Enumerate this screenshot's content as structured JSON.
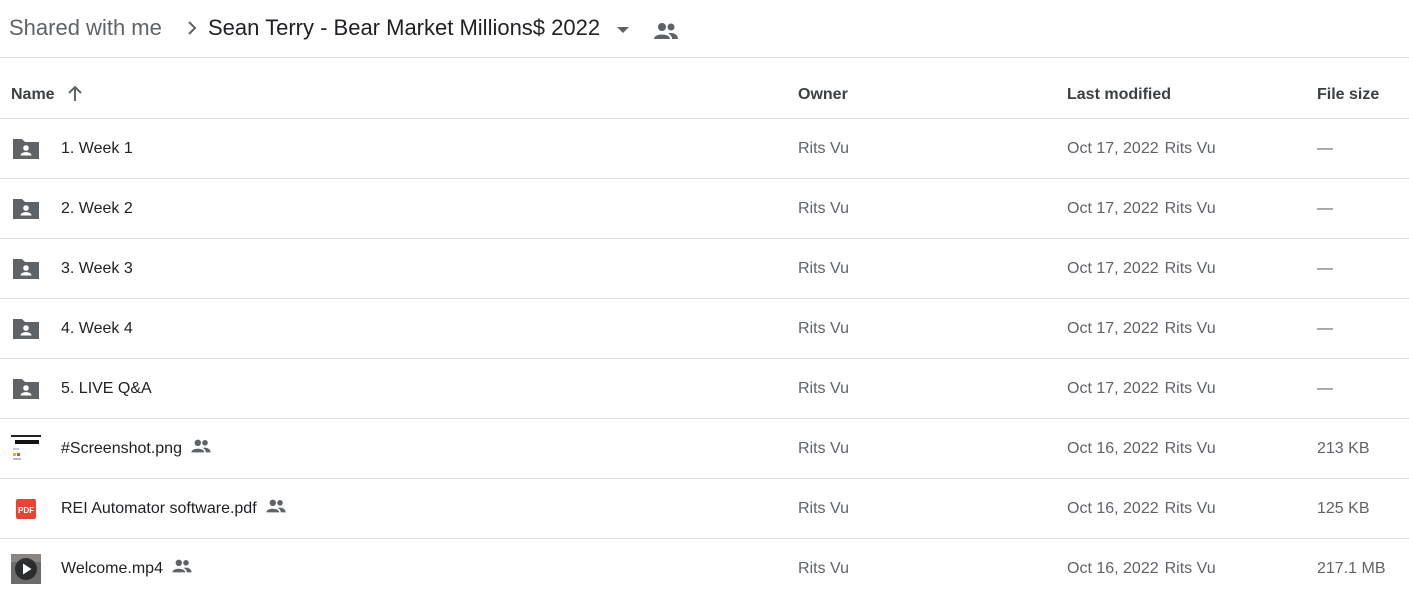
{
  "breadcrumb": {
    "root": "Shared with me",
    "current": "Sean Terry - Bear Market Millions$ 2022",
    "separator_icon": "chevron-right-icon",
    "dropdown_icon": "caret-down-icon",
    "shared_icon": "people-icon"
  },
  "columns": {
    "name": "Name",
    "owner": "Owner",
    "last_modified": "Last modified",
    "file_size": "File size",
    "sort_icon": "arrow-up-icon"
  },
  "colors": {
    "text_primary": "#202124",
    "text_secondary": "#5f6368",
    "divider": "#dadce0",
    "folder_icon": "#5f6368",
    "pdf_red": "#ea4335"
  },
  "files": [
    {
      "name": "1. Week 1",
      "type": "shared-folder",
      "icon": "shared-folder-icon",
      "owner": "Rits Vu",
      "modified_date": "Oct 17, 2022",
      "modified_by": "Rits Vu",
      "size": "—"
    },
    {
      "name": "2. Week 2",
      "type": "shared-folder",
      "icon": "shared-folder-icon",
      "owner": "Rits Vu",
      "modified_date": "Oct 17, 2022",
      "modified_by": "Rits Vu",
      "size": "—"
    },
    {
      "name": "3. Week 3",
      "type": "shared-folder",
      "icon": "shared-folder-icon",
      "owner": "Rits Vu",
      "modified_date": "Oct 17, 2022",
      "modified_by": "Rits Vu",
      "size": "—"
    },
    {
      "name": "4. Week 4",
      "type": "shared-folder",
      "icon": "shared-folder-icon",
      "owner": "Rits Vu",
      "modified_date": "Oct 17, 2022",
      "modified_by": "Rits Vu",
      "size": "—"
    },
    {
      "name": "5. LIVE Q&A",
      "type": "shared-folder",
      "icon": "shared-folder-icon",
      "owner": "Rits Vu",
      "modified_date": "Oct 17, 2022",
      "modified_by": "Rits Vu",
      "size": "—"
    },
    {
      "name": "#Screenshot.png",
      "type": "image",
      "icon": "image-thumbnail-icon",
      "shared": true,
      "owner": "Rits Vu",
      "modified_date": "Oct 16, 2022",
      "modified_by": "Rits Vu",
      "size": "213 KB"
    },
    {
      "name": "REI Automator software.pdf",
      "type": "pdf",
      "icon": "pdf-icon",
      "icon_label": "PDF",
      "shared": true,
      "owner": "Rits Vu",
      "modified_date": "Oct 16, 2022",
      "modified_by": "Rits Vu",
      "size": "125 KB"
    },
    {
      "name": "Welcome.mp4",
      "type": "video",
      "icon": "video-thumbnail-icon",
      "shared": true,
      "owner": "Rits Vu",
      "modified_date": "Oct 16, 2022",
      "modified_by": "Rits Vu",
      "size": "217.1 MB"
    }
  ]
}
